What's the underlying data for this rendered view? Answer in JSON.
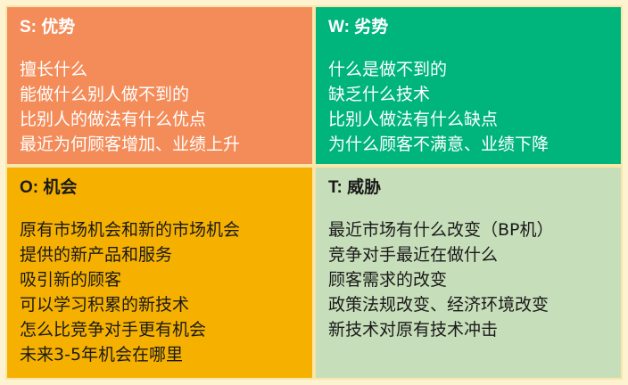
{
  "colors": {
    "background": "#fdf3d0",
    "strengths": "#f48c5a",
    "weaknesses": "#00b57c",
    "opportunities": "#f6b100",
    "threats": "#c7deba"
  },
  "quadrants": {
    "strengths": {
      "title": "S: 优势",
      "lines": [
        "擅长什么",
        "能做什么别人做不到的",
        "比别人的做法有什么优点",
        "最近为何顾客增加、业绩上升"
      ]
    },
    "weaknesses": {
      "title": "W: 劣势",
      "lines": [
        "什么是做不到的",
        "缺乏什么技术",
        "比别人做法有什么缺点",
        "为什么顾客不满意、业绩下降"
      ]
    },
    "opportunities": {
      "title": "O: 机会",
      "lines": [
        "原有市场机会和新的市场机会",
        "提供的新产品和服务",
        "吸引新的顾客",
        "可以学习积累的新技术",
        "怎么比竞争对手更有机会",
        "未来3-5年机会在哪里"
      ]
    },
    "threats": {
      "title": "T: 威胁",
      "lines": [
        "最近市场有什么改变（BP机）",
        "竞争对手最近在做什么",
        "顾客需求的改变",
        "政策法规改变、经济环境改变",
        "新技术对原有技术冲击"
      ]
    }
  }
}
